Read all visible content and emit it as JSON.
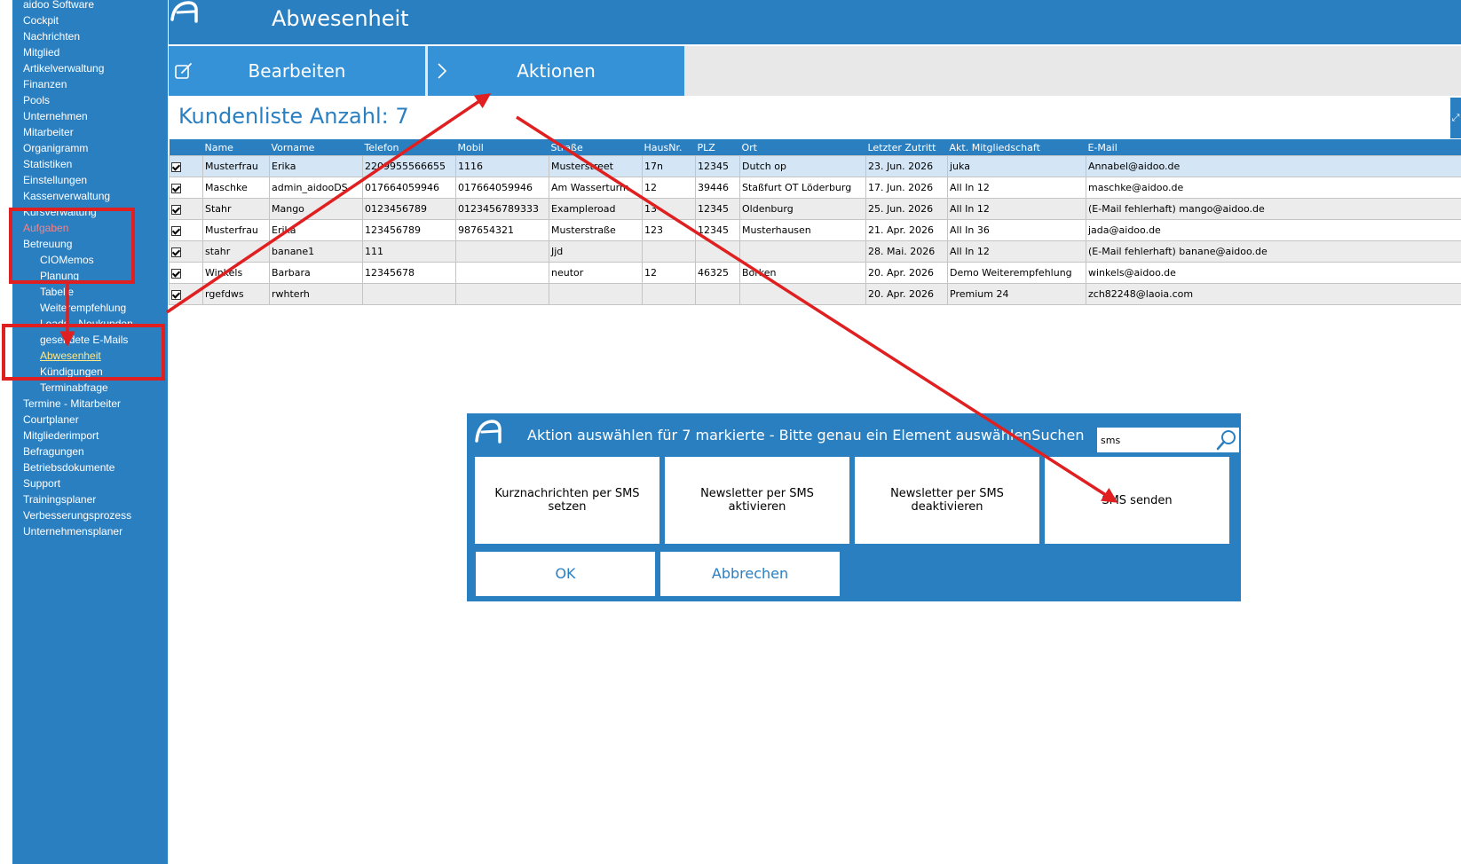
{
  "colors": {
    "primary": "#2a7fc1",
    "button": "#3592d6",
    "annotation": "#e02020",
    "highlight": "#ff8080",
    "current": "#ffe98a"
  },
  "sidebar": {
    "items": [
      {
        "label": "aidoo Software",
        "level": 0
      },
      {
        "label": "Cockpit",
        "level": 0
      },
      {
        "label": "Nachrichten",
        "level": 0
      },
      {
        "label": "Mitglied",
        "level": 0
      },
      {
        "label": "Artikelverwaltung",
        "level": 0
      },
      {
        "label": "Finanzen",
        "level": 0
      },
      {
        "label": "Pools",
        "level": 0
      },
      {
        "label": "Unternehmen",
        "level": 0
      },
      {
        "label": "Mitarbeiter",
        "level": 0
      },
      {
        "label": "Organigramm",
        "level": 0
      },
      {
        "label": "Statistiken",
        "level": 0
      },
      {
        "label": "Einstellungen",
        "level": 0
      },
      {
        "label": "Kassenverwaltung",
        "level": 0
      },
      {
        "label": "Kursverwaltung",
        "level": 0
      },
      {
        "label": "Aufgaben",
        "level": 0,
        "state": "highlight"
      },
      {
        "label": "Betreuung",
        "level": 0
      },
      {
        "label": "CIOMemos",
        "level": 1
      },
      {
        "label": "Planung",
        "level": 1
      },
      {
        "label": "Tabelle",
        "level": 1
      },
      {
        "label": "Weiterempfehlung",
        "level": 1
      },
      {
        "label": "Leads - Neukunden",
        "level": 1
      },
      {
        "label": "gesendete E-Mails",
        "level": 1
      },
      {
        "label": "Abwesenheit",
        "level": 1,
        "state": "current"
      },
      {
        "label": "Kündigungen",
        "level": 1
      },
      {
        "label": "Terminabfrage",
        "level": 1
      },
      {
        "label": "Termine - Mitarbeiter",
        "level": 0
      },
      {
        "label": "Courtplaner",
        "level": 0
      },
      {
        "label": "Mitgliederimport",
        "level": 0
      },
      {
        "label": "Befragungen",
        "level": 0
      },
      {
        "label": "Betriebsdokumente",
        "level": 0
      },
      {
        "label": "Support",
        "level": 0
      },
      {
        "label": "Trainingsplaner",
        "level": 0
      },
      {
        "label": "Verbesserungsprozess",
        "level": 0
      },
      {
        "label": "Unternehmensplaner",
        "level": 0
      }
    ]
  },
  "header": {
    "title": "Abwesenheit",
    "logo_icon": "aidoo-logo-icon"
  },
  "toolbar": {
    "edit_label": "Bearbeiten",
    "edit_icon": "edit-icon",
    "actions_label": "Aktionen",
    "actions_icon": "chevron-right-icon"
  },
  "list": {
    "title": "Kundenliste Anzahl: 7",
    "columns": [
      "",
      "Name",
      "Vorname",
      "Telefon",
      "Mobil",
      "Straße",
      "HausNr.",
      "PLZ",
      "Ort",
      "Letzter Zutritt",
      "Akt. Mitgliedschaft",
      "E-Mail"
    ],
    "rows": [
      {
        "checked": true,
        "cells": [
          "Musterfrau",
          "Erika",
          "2209955566655",
          "1116",
          "Musterstreet",
          "17n",
          "12345",
          "Dutch op",
          "23. Jun. 2026",
          "juka",
          "Annabel@aidoo.de"
        ]
      },
      {
        "checked": true,
        "cells": [
          "Maschke",
          "admin_aidooDS",
          "017664059946",
          "017664059946",
          "Am Wasserturm",
          "12",
          "39446",
          "Staßfurt OT Löderburg",
          "17. Jun. 2026",
          "All In 12",
          "maschke@aidoo.de"
        ]
      },
      {
        "checked": true,
        "cells": [
          "Stahr",
          "Mango",
          "0123456789",
          "0123456789333",
          "Exampleroad",
          "13",
          "12345",
          "Oldenburg",
          "25. Jun. 2026",
          "All In 12",
          "(E-Mail fehlerhaft) mango@aidoo.de"
        ]
      },
      {
        "checked": true,
        "cells": [
          "Musterfrau",
          "Erika",
          "123456789",
          "987654321",
          "Musterstraße",
          "123",
          "12345",
          "Musterhausen",
          "21. Apr. 2026",
          "All In 36",
          "jada@aidoo.de"
        ]
      },
      {
        "checked": true,
        "cells": [
          "stahr",
          "banane1",
          "111",
          "",
          "Jjd",
          "",
          "",
          "",
          "28. Mai. 2026",
          "All In 12",
          "(E-Mail fehlerhaft) banane@aidoo.de"
        ]
      },
      {
        "checked": true,
        "cells": [
          "Winkels",
          "Barbara",
          "12345678",
          "",
          "neutor",
          "12",
          "46325",
          "Borken",
          "20. Apr. 2026",
          "Demo Weiterempfehlung",
          "winkels@aidoo.de"
        ]
      },
      {
        "checked": true,
        "cells": [
          "rgefdws",
          "rwhterh",
          "",
          "",
          "",
          "",
          "",
          "",
          "20. Apr. 2026",
          "Premium 24",
          "zch82248@laoia.com"
        ]
      }
    ]
  },
  "dialog": {
    "title": "Aktion auswählen für 7 markierte - Bitte genau ein Element auswählen",
    "search_label": "Suchen",
    "search_value": "sms",
    "search_icon": "search-icon",
    "options": [
      "Kurznachrichten per SMS setzen",
      "Newsletter per SMS aktivieren",
      "Newsletter per SMS deaktivieren",
      "SMS senden"
    ],
    "ok_label": "OK",
    "cancel_label": "Abbrechen"
  }
}
